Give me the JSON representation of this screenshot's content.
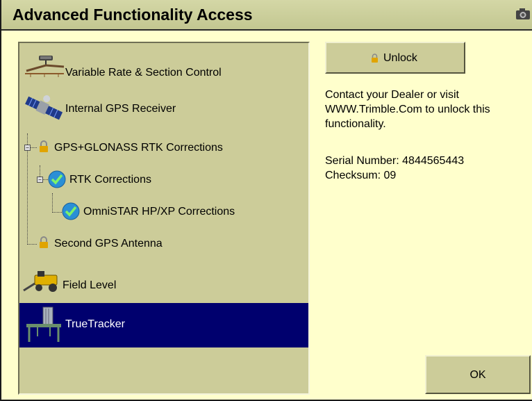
{
  "window": {
    "title": "Advanced Functionality Access"
  },
  "tree": {
    "items": [
      {
        "label": "Variable Rate & Section Control",
        "icon": "sprayer-icon"
      },
      {
        "label": "Internal GPS Receiver",
        "icon": "satellite-icon"
      },
      {
        "label": "GPS+GLONASS RTK Corrections",
        "icon": "lock-icon"
      },
      {
        "label": "RTK Corrections",
        "icon": "check-icon"
      },
      {
        "label": "OmniSTAR HP/XP Corrections",
        "icon": "check-icon"
      },
      {
        "label": "Second GPS Antenna",
        "icon": "lock-icon"
      },
      {
        "label": "Field Level",
        "icon": "scraper-icon"
      },
      {
        "label": "TrueTracker",
        "icon": "implement-icon",
        "selected": true
      }
    ]
  },
  "unlock_button": {
    "label": "Unlock"
  },
  "info": {
    "message_lines": [
      "Contact your Dealer or visit",
      "WWW.Trimble.Com to unlock this",
      "functionality."
    ],
    "serial": "Serial Number: 4844565443",
    "checksum": "Checksum: 09"
  },
  "ok_button": {
    "label": "OK"
  },
  "colors": {
    "background": "#ffffcc",
    "panel": "#cccc99",
    "selected": "#00006e",
    "check": "#2a8fd6"
  }
}
